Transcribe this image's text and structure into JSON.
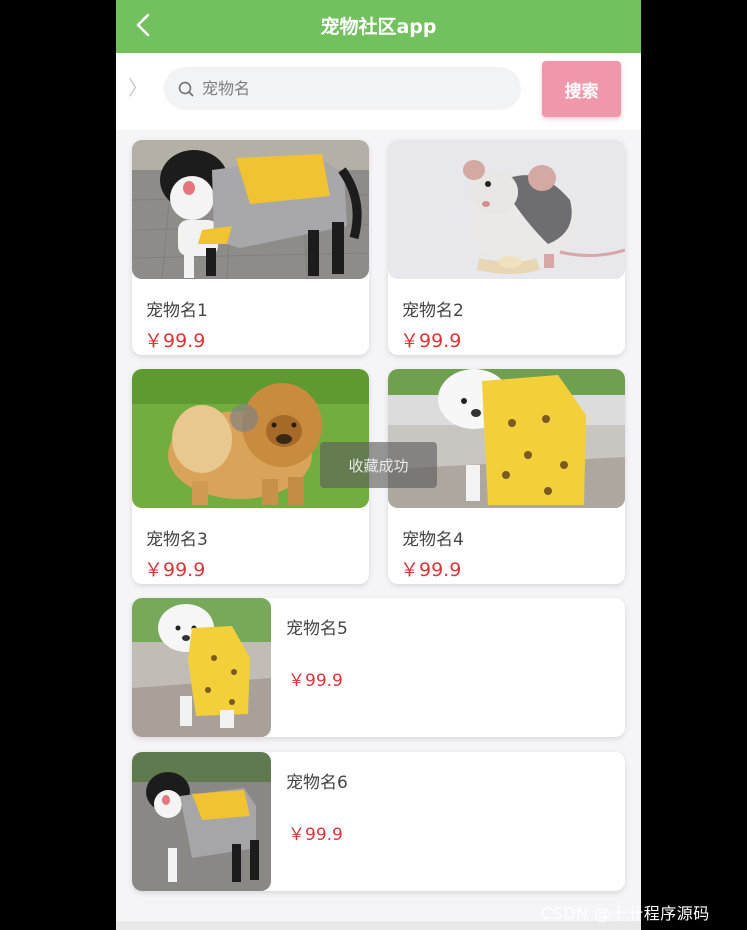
{
  "header": {
    "title": "宠物社区app",
    "back_icon": "chevron-left-icon"
  },
  "search": {
    "placeholder": "宠物名",
    "button_label": "搜索",
    "expand_symbol": "〉"
  },
  "grid_items": [
    {
      "name": "宠物名1",
      "price": "￥99.9",
      "image": "border-collie-in-coat"
    },
    {
      "name": "宠物名2",
      "price": "￥99.9",
      "image": "rat"
    },
    {
      "name": "宠物名3",
      "price": "￥99.9",
      "image": "chow-chow"
    },
    {
      "name": "宠物名4",
      "price": "￥99.9",
      "image": "poodle-in-sponge-hoodie"
    }
  ],
  "list_items": [
    {
      "name": "宠物名5",
      "price": "￥99.9",
      "image": "poodle-in-sponge-hoodie"
    },
    {
      "name": "宠物名6",
      "price": "￥99.9",
      "image": "border-collie-in-coat"
    }
  ],
  "toast": {
    "text": "收藏成功"
  },
  "watermark": "CSDN @十卄程序源码",
  "colors": {
    "header": "#72c15e",
    "search_button": "#ef97ab",
    "price": "#d8363a"
  }
}
